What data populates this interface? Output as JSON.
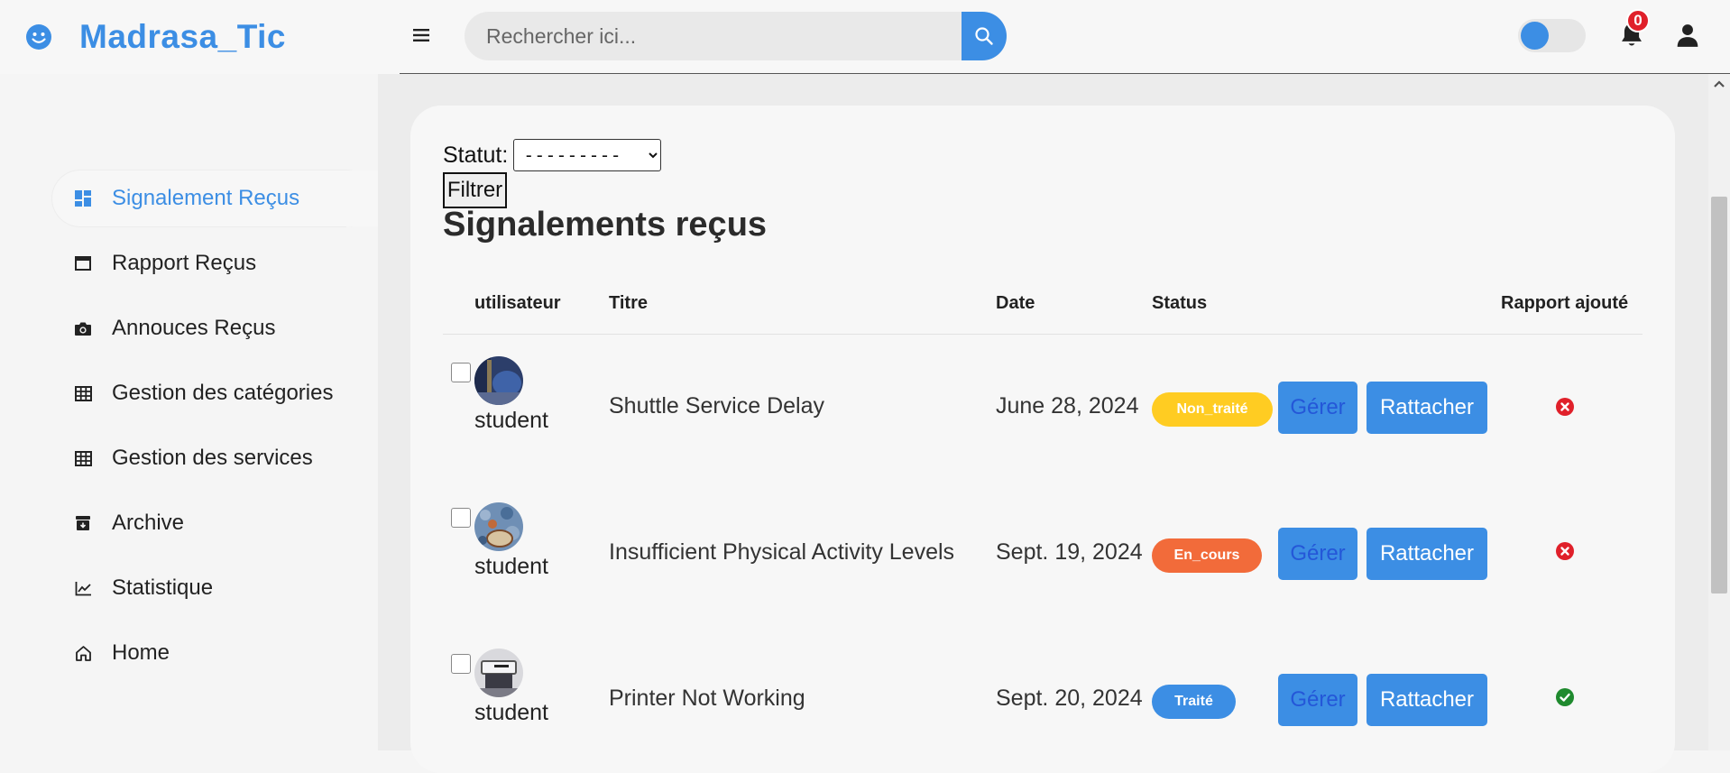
{
  "header": {
    "app_name": "Madrasa_Tic",
    "search_placeholder": "Rechercher ici...",
    "notification_count": "0"
  },
  "sidebar": {
    "items": [
      {
        "label": "Signalement Reçus",
        "icon": "dashboard-icon",
        "active": true
      },
      {
        "label": "Rapport Reçus",
        "icon": "window-icon"
      },
      {
        "label": "Annouces Reçus",
        "icon": "camera-icon"
      },
      {
        "label": "Gestion des catégories",
        "icon": "table-icon"
      },
      {
        "label": "Gestion des services",
        "icon": "table-icon"
      },
      {
        "label": "Archive",
        "icon": "archive-icon"
      },
      {
        "label": "Statistique",
        "icon": "chart-line-icon"
      },
      {
        "label": "Home",
        "icon": "home-icon"
      }
    ]
  },
  "filter": {
    "label": "Statut:",
    "selected": "---------",
    "button": "Filtrer"
  },
  "main": {
    "title": "Signalements reçus",
    "columns": [
      "utilisateur",
      "Titre",
      "Date",
      "Status",
      "Rapport ajouté"
    ],
    "rows": [
      {
        "user": "student",
        "title": "Shuttle Service Delay",
        "date": "June 28, 2024",
        "status": "Non_traité",
        "status_color": "#ffcc22",
        "manage": "Gérer",
        "attach": "Rattacher",
        "report_added": false
      },
      {
        "user": "student",
        "title": "Insufficient Physical Activity Levels",
        "date": "Sept. 19, 2024",
        "status": "En_cours",
        "status_color": "#f26b3a",
        "manage": "Gérer",
        "attach": "Rattacher",
        "report_added": false
      },
      {
        "user": "student",
        "title": "Printer Not Working",
        "date": "Sept. 20, 2024",
        "status": "Traité",
        "status_color": "#3c8ee4",
        "manage": "Gérer",
        "attach": "Rattacher",
        "report_added": true
      }
    ]
  },
  "colors": {
    "accent": "#3c8ee4",
    "danger": "#e0202a",
    "success": "#1f8a2e"
  }
}
